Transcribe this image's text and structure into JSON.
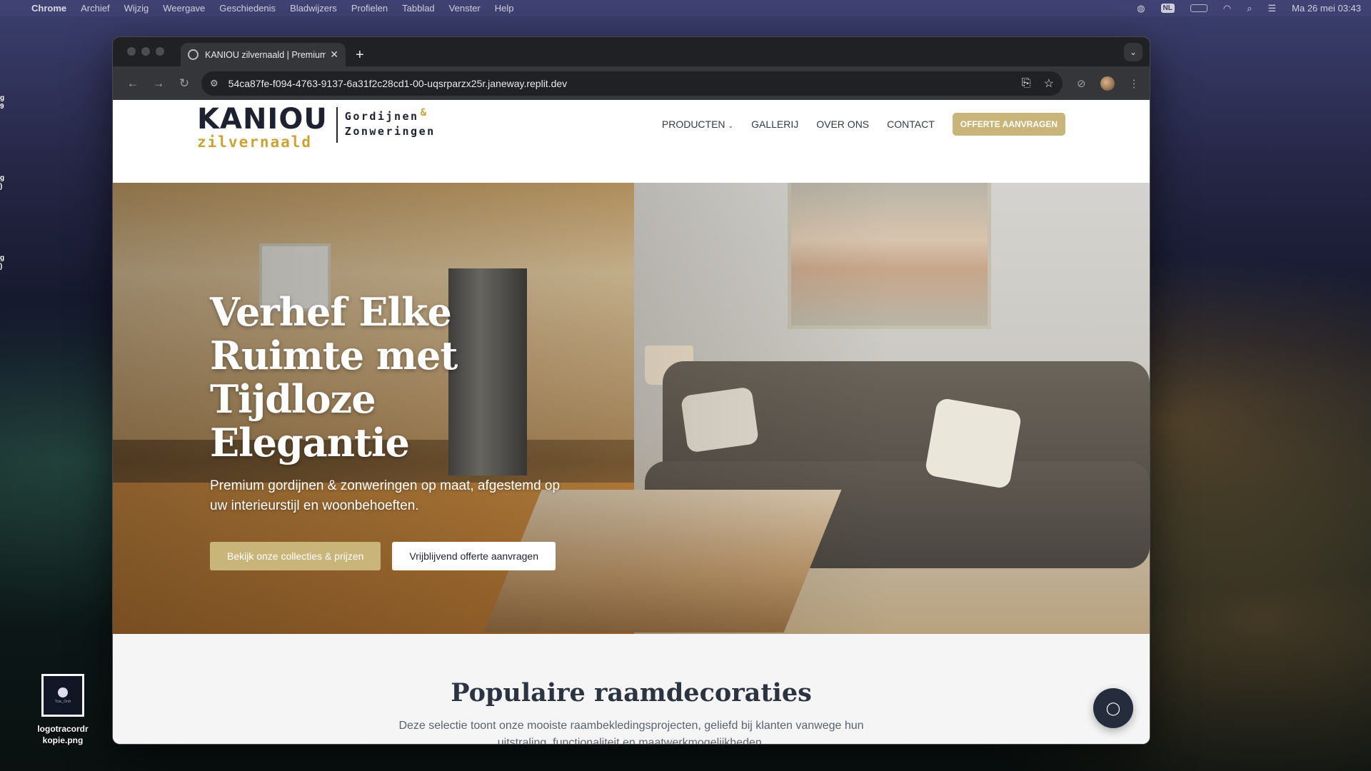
{
  "menubar": {
    "app": "Chrome",
    "items": [
      "Archief",
      "Wijzig",
      "Weergave",
      "Geschiedenis",
      "Bladwijzers",
      "Profielen",
      "Tabblad",
      "Venster",
      "Help"
    ],
    "input_source": "NL",
    "datetime": "Ma 26 mei  03:43"
  },
  "desktop": {
    "file_label": "logotracordr kopie.png",
    "file_icon_text": "Trac_Ordr"
  },
  "browser": {
    "tab_title": "KANIOU zilvernaald | Premium",
    "url": "54ca87fe-f094-4763-9137-6a31f2c28cd1-00-uqsrparzx25r.janeway.replit.dev"
  },
  "site": {
    "logo": {
      "brand": "KANIOU",
      "sub": "zilvernaald",
      "line1": "Gordijnen",
      "amp": "&",
      "line2": "Zonweringen"
    },
    "nav": {
      "products": "PRODUCTEN",
      "gallery": "GALLERIJ",
      "about": "OVER ONS",
      "contact": "CONTACT",
      "cta": "OFFERTE AANVRAGEN"
    },
    "hero": {
      "title": "Verhef Elke Ruimte met Tijdloze Elegantie",
      "subtitle": "Premium gordijnen & zonweringen op maat, afgestemd op uw interieurstijl en woonbehoeften.",
      "primary_btn": "Bekijk onze collecties & prijzen",
      "secondary_btn": "Vrijblijvend offerte aanvragen"
    },
    "section": {
      "title": "Populaire raamdecoraties",
      "text": "Deze selectie toont onze mooiste raambekledingsprojecten, geliefd bij klanten vanwege hun uitstraling, functionaliteit en maatwerkmogelijkheden."
    }
  },
  "icons": {
    "apple": "apple-logo-icon",
    "chat": "chat-bubble-icon"
  },
  "colors": {
    "gold": "#c9b479",
    "navy": "#1e2230",
    "chat_bg": "#252d3d"
  }
}
